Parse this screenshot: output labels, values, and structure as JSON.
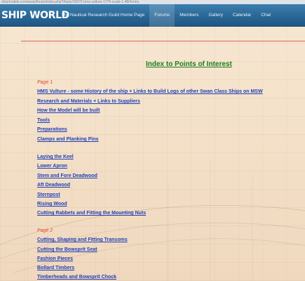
{
  "browser": {
    "url": "shipmodels.com/www/forum/index.php?/topic/15975-hms-vulture-1776-scale-1-48/#entry"
  },
  "header": {
    "logo": "SHIP WORLD",
    "nav": [
      {
        "label": "The Nautical Research Guild Home Page"
      },
      {
        "label": "Forums"
      },
      {
        "label": "Members"
      },
      {
        "label": "Gallery"
      },
      {
        "label": "Calendar"
      },
      {
        "label": "Chat"
      }
    ]
  },
  "content": {
    "title": "Index to Points of Interest",
    "page1_label": "Page 1",
    "page1_links_a": [
      "HMS Vulture - some History of the ship + Links to Build Logs of other Swan Class Ships on MSW",
      "Research and Materials + Links to Suppliers",
      "How the Model will be built",
      "Tools",
      "Preparations",
      "Clamps and Planking Pins"
    ],
    "page1_links_b": [
      "Laying the Keel",
      "Lower Apron",
      "Stem and Fore Deadwood",
      "Aft Deadwood",
      "Sternpost",
      "Rising Wood",
      "Cutting Rabbets and Fitting the Mounting Nuts"
    ],
    "page2_label": "Page 2",
    "page2_links": [
      "Cutting, Shaping and Fitting Transoms",
      "Cutting the Bowsprit Seat",
      "Fashion Pieces",
      "Bollard Timbers",
      "Timberheads and Bowsprit Chock"
    ]
  },
  "colors": {
    "nav_bar": "#2a6797",
    "title_green": "#1a7f1a",
    "link_blue": "#1f3fb8",
    "page_label_red": "#d94a2a",
    "parchment": "#f4e1c9"
  }
}
